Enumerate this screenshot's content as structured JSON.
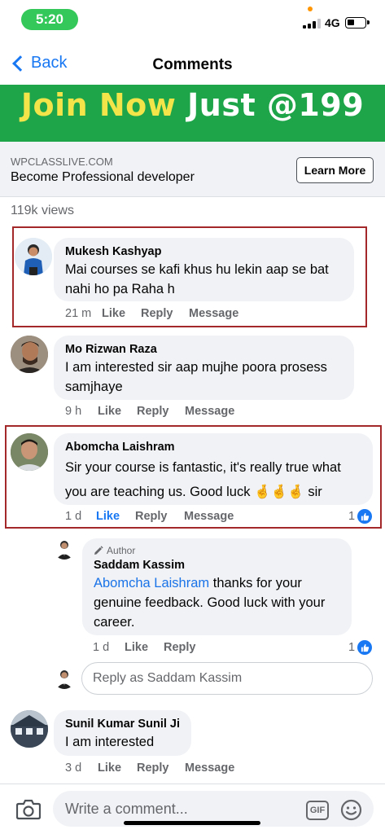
{
  "status_bar": {
    "time": "5:20",
    "network": "4G"
  },
  "nav": {
    "back_label": "Back",
    "title": "Comments"
  },
  "ad": {
    "banner_yellow": "Join Now",
    "banner_white": "Just @199",
    "domain": "WPCLASSLIVE.COM",
    "headline": "Become Professional developer",
    "cta": "Learn More"
  },
  "views": "119k views",
  "comments": [
    {
      "author": "Mukesh Kashyap",
      "text": "Mai courses se kafi khus hu lekin aap se bat nahi ho pa Raha h",
      "time": "21 m",
      "like": "Like",
      "reply": "Reply",
      "message": "Message"
    },
    {
      "author": "Mo Rizwan Raza",
      "text": "I am interested sir aap mujhe poora prosess samjhaye",
      "time": "9 h",
      "like": "Like",
      "reply": "Reply",
      "message": "Message"
    },
    {
      "author": "Abomcha Laishram",
      "text": "Sir your course is fantastic, it's really true what you are teaching us. Good luck",
      "emoji": "🤞🤞🤞",
      "text_end": "sir",
      "time": "1 d",
      "like": "Like",
      "reply": "Reply",
      "message": "Message",
      "reaction_count": "1"
    },
    {
      "author": "Sunil Kumar Sunil Ji",
      "text": "I am interested",
      "time": "3 d",
      "like": "Like",
      "reply": "Reply",
      "message": "Message"
    }
  ],
  "author_reply": {
    "tag": "Author",
    "author": "Saddam Kassim",
    "mention": "Abomcha Laishram",
    "text": " thanks for your genuine feedback. Good luck with your career.",
    "time": "1 d",
    "like": "Like",
    "reply": "Reply",
    "reaction_count": "1"
  },
  "reply_box": {
    "placeholder": "Reply as Saddam Kassim"
  },
  "composer": {
    "placeholder": "Write a comment...",
    "gif_label": "GIF"
  },
  "icons": [
    "chevron-left-icon",
    "camera-icon",
    "gif-icon",
    "smiley-icon",
    "pencil-icon",
    "thumbs-up-icon"
  ],
  "colors": {
    "accent": "#1877f2",
    "banner": "#1ea54a",
    "banner_yellow": "#f3e44a",
    "highlight": "#a3282a",
    "time_pill": "#34c759"
  }
}
